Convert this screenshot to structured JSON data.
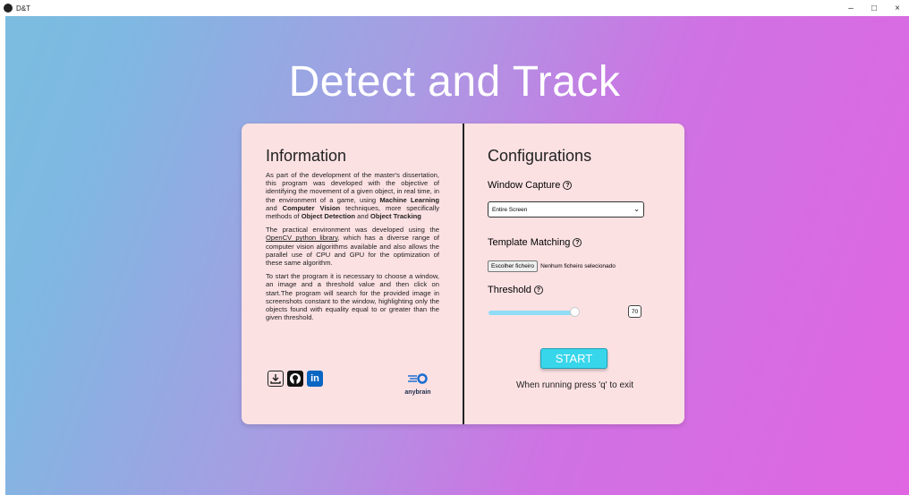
{
  "window": {
    "title": "D&T",
    "controls": [
      "–",
      "□",
      "×"
    ]
  },
  "page": {
    "title": "Detect and Track"
  },
  "info": {
    "heading": "Information",
    "p1_a": "As part of the development of the master's dissertation, this program was developed with the objective of identifying the movement of a given object, in real time, in the environment of a game, using ",
    "p1_b1": "Machine Learning",
    "p1_and": " and ",
    "p1_b2": "Computer Vision",
    "p1_c": " techniques, more specifically methods of ",
    "p1_b3": "Object Detection",
    "p1_and2": " and ",
    "p1_b4": "Object Tracking",
    "p2_a": "The practical environment was developed using the ",
    "p2_link": "OpenCV python library",
    "p2_b": ", which has a diverse range of computer vision algorithms available and also allows the parallel use of CPU and GPU for the optimization of these same algorithm.",
    "p3": "To start the program it is necessary to choose a window, an image and a threshold value and then click on start.The program will search for the provided image in screenshots constant to the window, highlighting only the objects found with equality equal to or greater than the given threshold.",
    "icons": [
      "download-icon",
      "github-icon",
      "linkedin-icon"
    ],
    "linkedin_text": "in",
    "brand": "anybrain"
  },
  "config": {
    "heading": "Configurations",
    "window_capture_label": "Window Capture",
    "window_capture_value": "Entire Screen",
    "template_label": "Template Matching",
    "file_button": "Escolher ficheiro",
    "file_status": "Nenhum ficheiro selecionado",
    "threshold_label": "Threshold",
    "threshold_value": "70",
    "threshold_fraction": 0.7,
    "help_glyph": "?",
    "start_label": "START",
    "hint": "When running press 'q' to exit"
  },
  "colors": {
    "accent": "#38d6eb",
    "card": "#fce1e3",
    "slider": "#8fdcf5"
  }
}
